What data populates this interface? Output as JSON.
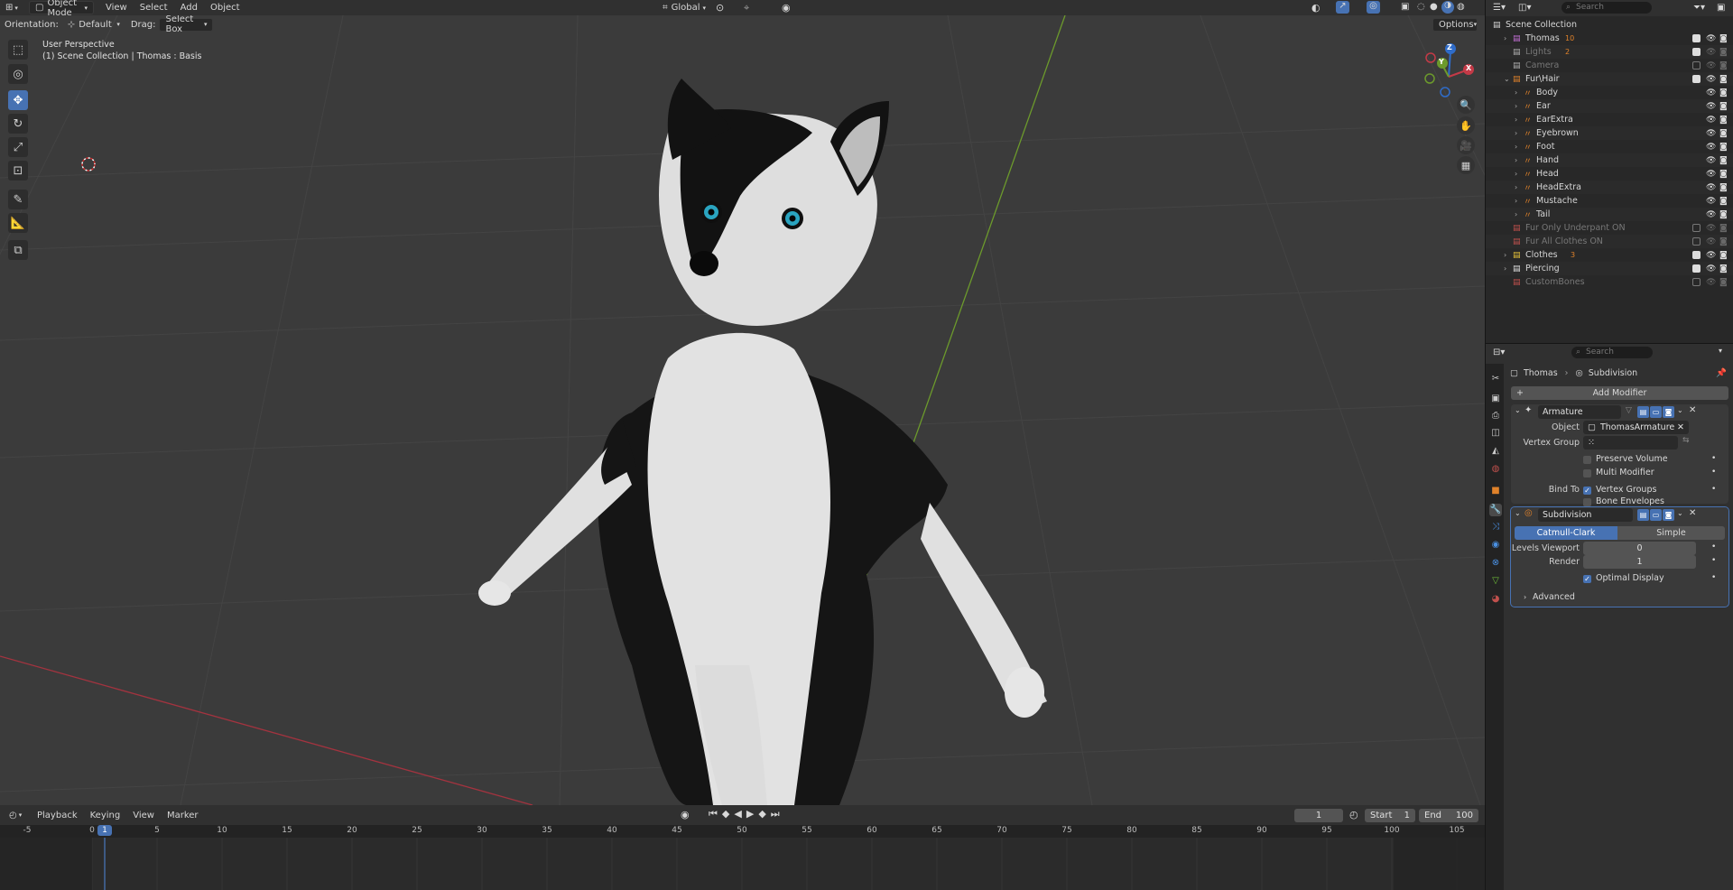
{
  "header": {
    "mode": "Object Mode",
    "menus": [
      "View",
      "Select",
      "Add",
      "Object"
    ],
    "transform_orientation": "Global",
    "search_placeholder": "Search"
  },
  "toolbar_row": {
    "orientation_label": "Orientation:",
    "orientation_value": "Default",
    "drag_label": "Drag:",
    "drag_value": "Select Box",
    "options_label": "Options"
  },
  "viewport": {
    "view_name": "User Perspective",
    "context": "(1) Scene Collection | Thomas : Basis",
    "gizmo_axes": [
      "Z",
      "Y",
      "X"
    ]
  },
  "outliner": {
    "search_placeholder": "Search",
    "root": "Scene Collection",
    "rows": [
      {
        "label": "Thomas",
        "indent": 1,
        "icon_color": "#c46fd6",
        "checked": true,
        "dim": false,
        "badge": "10"
      },
      {
        "label": "Lights",
        "indent": 1,
        "icon_color": "#b0b0b0",
        "checked": true,
        "dim": true,
        "badge": "2"
      },
      {
        "label": "Camera",
        "indent": 1,
        "icon_color": "#b0b0b0",
        "checked": false,
        "dim": true,
        "badge": ""
      },
      {
        "label": "Fur\\Hair",
        "indent": 1,
        "icon_color": "#e0822a",
        "checked": true,
        "dim": false,
        "badge": ""
      },
      {
        "label": "Body",
        "indent": 2,
        "icon_color": "#e0822a",
        "checked": null,
        "dim": false,
        "badge": ""
      },
      {
        "label": "Ear",
        "indent": 2,
        "icon_color": "#e0822a",
        "checked": null,
        "dim": false,
        "badge": ""
      },
      {
        "label": "EarExtra",
        "indent": 2,
        "icon_color": "#e0822a",
        "checked": null,
        "dim": false,
        "badge": ""
      },
      {
        "label": "Eyebrown",
        "indent": 2,
        "icon_color": "#e0822a",
        "checked": null,
        "dim": false,
        "badge": ""
      },
      {
        "label": "Foot",
        "indent": 2,
        "icon_color": "#e0822a",
        "checked": null,
        "dim": false,
        "badge": ""
      },
      {
        "label": "Hand",
        "indent": 2,
        "icon_color": "#e0822a",
        "checked": null,
        "dim": false,
        "badge": ""
      },
      {
        "label": "Head",
        "indent": 2,
        "icon_color": "#e0822a",
        "checked": null,
        "dim": false,
        "badge": ""
      },
      {
        "label": "HeadExtra",
        "indent": 2,
        "icon_color": "#e0822a",
        "checked": null,
        "dim": false,
        "badge": ""
      },
      {
        "label": "Mustache",
        "indent": 2,
        "icon_color": "#e0822a",
        "checked": null,
        "dim": false,
        "badge": ""
      },
      {
        "label": "Tail",
        "indent": 2,
        "icon_color": "#e0822a",
        "checked": null,
        "dim": false,
        "badge": ""
      },
      {
        "label": "Fur Only Underpant ON",
        "indent": 1,
        "icon_color": "#c0504d",
        "checked": false,
        "dim": true,
        "badge": ""
      },
      {
        "label": "Fur All Clothes ON",
        "indent": 1,
        "icon_color": "#c0504d",
        "checked": false,
        "dim": true,
        "badge": ""
      },
      {
        "label": "Clothes",
        "indent": 1,
        "icon_color": "#e8c33a",
        "checked": true,
        "dim": false,
        "badge": "3"
      },
      {
        "label": "Piercing",
        "indent": 1,
        "icon_color": "#e0e0e0",
        "checked": true,
        "dim": false,
        "badge": ""
      },
      {
        "label": "CustomBones",
        "indent": 1,
        "icon_color": "#c0504d",
        "checked": false,
        "dim": true,
        "badge": ""
      }
    ]
  },
  "properties": {
    "search_placeholder": "Search",
    "breadcrumb_object": "Thomas",
    "breadcrumb_modifier": "Subdivision",
    "add_modifier": "Add Modifier",
    "armature": {
      "name": "Armature",
      "object_label": "Object",
      "object_value": "ThomasArmature",
      "vertex_group_label": "Vertex Group",
      "preserve_volume": "Preserve Volume",
      "multi_modifier": "Multi Modifier",
      "bind_to_label": "Bind To",
      "vertex_groups": "Vertex Groups",
      "bone_envelopes": "Bone Envelopes"
    },
    "subdivision": {
      "name": "Subdivision",
      "method_a": "Catmull-Clark",
      "method_b": "Simple",
      "levels_viewport_label": "Levels Viewport",
      "levels_viewport_value": "0",
      "render_label": "Render",
      "render_value": "1",
      "optimal_display": "Optimal Display",
      "advanced": "Advanced"
    }
  },
  "timeline": {
    "menus": [
      "Playback",
      "Keying",
      "View",
      "Marker"
    ],
    "current_frame": "1",
    "start_label": "Start",
    "start_value": "1",
    "end_label": "End",
    "end_value": "100",
    "ruler_labels": [
      "-5",
      "0",
      "1",
      "5",
      "10",
      "15",
      "20",
      "25",
      "30",
      "35",
      "40",
      "45",
      "50",
      "55",
      "60",
      "65",
      "70",
      "75",
      "80",
      "85",
      "90",
      "95",
      "100",
      "105"
    ]
  },
  "colors": {
    "accent": "#4772b3",
    "x_axis": "#a3333f",
    "y_axis": "#6c9a2c",
    "panel": "#303030",
    "viewport_bg": "#3b3b3b"
  }
}
